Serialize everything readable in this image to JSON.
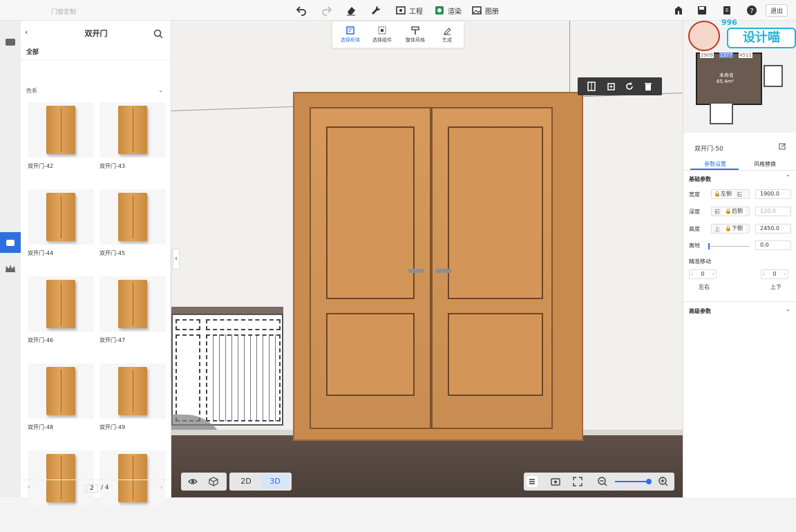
{
  "topbar": {
    "app_title": "门窗定制",
    "project_label": "工程",
    "render_label": "渲染",
    "album_label": "图册",
    "exit_label": "退出"
  },
  "catalog": {
    "title": "双开门",
    "category": "全部",
    "filter_label": "色系",
    "items": [
      {
        "name": "双开门-42"
      },
      {
        "name": "双开门-43"
      },
      {
        "name": "双开门-44"
      },
      {
        "name": "双开门-45"
      },
      {
        "name": "双开门-46"
      },
      {
        "name": "双开门-47"
      },
      {
        "name": "双开门-48"
      },
      {
        "name": "双开门-49"
      },
      {
        "name": ""
      },
      {
        "name": ""
      }
    ],
    "pager": {
      "current": "2",
      "total": "/ 4"
    }
  },
  "mode_bar": {
    "items": [
      {
        "label": "选择柜体",
        "active": true
      },
      {
        "label": "选择组件",
        "active": false
      },
      {
        "label": "整体风格",
        "active": false
      },
      {
        "label": "生成",
        "active": false
      }
    ]
  },
  "view_controls": {
    "btn_2d": "2D",
    "btn_3d": "3D",
    "active": "3D",
    "zoom_fraction": 0.95
  },
  "minimap": {
    "dim_left": "2909",
    "dim_mid": "1377",
    "dim_right": "4511",
    "room_name": "未命名",
    "room_area": "65.4m²"
  },
  "brand": {
    "logo_number": "996",
    "logo_text": "设计喵"
  },
  "props": {
    "object_name": "双开门-50",
    "tab_params": "参数设置",
    "tab_style": "风格替换",
    "section_basic": "基础参数",
    "width_label": "宽度",
    "width_seg_left": "左侧",
    "width_seg_right": "右",
    "width_value": "1900.0",
    "depth_label": "深度",
    "depth_seg_front": "前",
    "depth_seg_back": "后侧",
    "depth_value": "120.0",
    "height_label": "高度",
    "height_seg_top": "上",
    "height_seg_bottom": "下侧",
    "height_value": "2450.0",
    "ground_label": "离地",
    "ground_value": "0.0",
    "ground_fraction": 0.0,
    "precise_label": "精准移动",
    "lr_value": "0",
    "lr_label": "左右",
    "ud_value": "0",
    "ud_label": "上下",
    "section_advanced": "高级参数"
  },
  "colors": {
    "accent": "#2f6fe0",
    "wood": "#d39556",
    "dark_bar": "#3a3a3a"
  }
}
